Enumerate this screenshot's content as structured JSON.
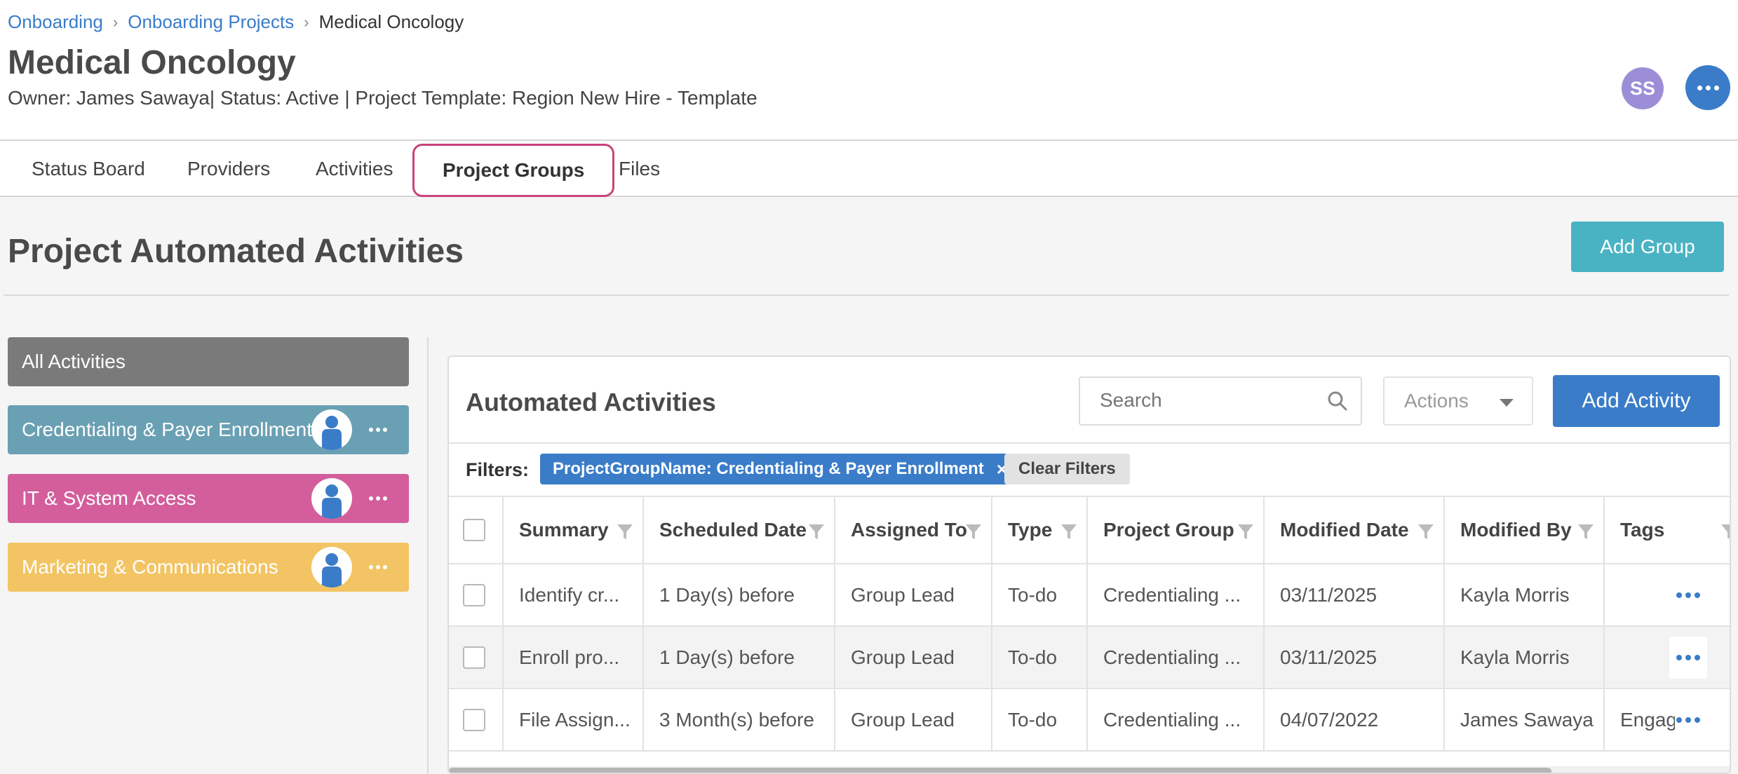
{
  "breadcrumb": {
    "items": [
      "Onboarding",
      "Onboarding Projects",
      "Medical Oncology"
    ]
  },
  "page": {
    "title": "Medical Oncology",
    "subtitle": "Owner: James Sawaya| Status: Active | Project Template: Region New Hire - Template",
    "avatar_initials": "SS"
  },
  "tabs": [
    "Status Board",
    "Providers",
    "Activities",
    "Project Groups",
    "Files"
  ],
  "active_tab": "Project Groups",
  "section": {
    "title": "Project Automated Activities",
    "add_group_label": "Add Group"
  },
  "groups": [
    {
      "label": "All Activities",
      "color": "#7a7a7a"
    },
    {
      "label": "Credentialing & Payer Enrollment",
      "color": "#6aa0b3"
    },
    {
      "label": "IT & System Access",
      "color": "#d45e9c"
    },
    {
      "label": "Marketing & Communications",
      "color": "#f3c463"
    }
  ],
  "panel": {
    "title": "Automated Activities",
    "search_placeholder": "Search",
    "actions_label": "Actions",
    "add_activity_label": "Add Activity",
    "filters_label": "Filters:",
    "filter_chip": "ProjectGroupName: Credentialing & Payer Enrollment",
    "filter_chip_remove": "×",
    "clear_filters_label": "Clear Filters"
  },
  "table": {
    "columns": [
      "Summary",
      "Scheduled Date",
      "Assigned To",
      "Type",
      "Project Group",
      "Modified Date",
      "Modified By",
      "Tags"
    ],
    "rows": [
      [
        "Identify cr...",
        "1 Day(s) before",
        "Group Lead",
        "To-do",
        "Credentialing ...",
        "03/11/2025",
        "Kayla Morris",
        ""
      ],
      [
        "Enroll pro...",
        "1 Day(s) before",
        "Group Lead",
        "To-do",
        "Credentialing ...",
        "03/11/2025",
        "Kayla Morris",
        ""
      ],
      [
        "File Assign...",
        "3 Month(s) before",
        "Group Lead",
        "To-do",
        "Credentialing ...",
        "04/07/2022",
        "James Sawaya",
        "Engage"
      ]
    ]
  },
  "colors": {
    "link": "#3a7cc8",
    "primary_button": "#3a7cc8",
    "add_group_button": "#4ab3c3",
    "active_tab_outline": "#c9447a",
    "avatar": "#9c8ed6"
  },
  "icons": {
    "search": "search-icon",
    "filter": "funnel-icon",
    "more": "ellipsis-icon",
    "person": "person-icon",
    "close": "close-icon",
    "caret": "chevron-down-icon"
  }
}
